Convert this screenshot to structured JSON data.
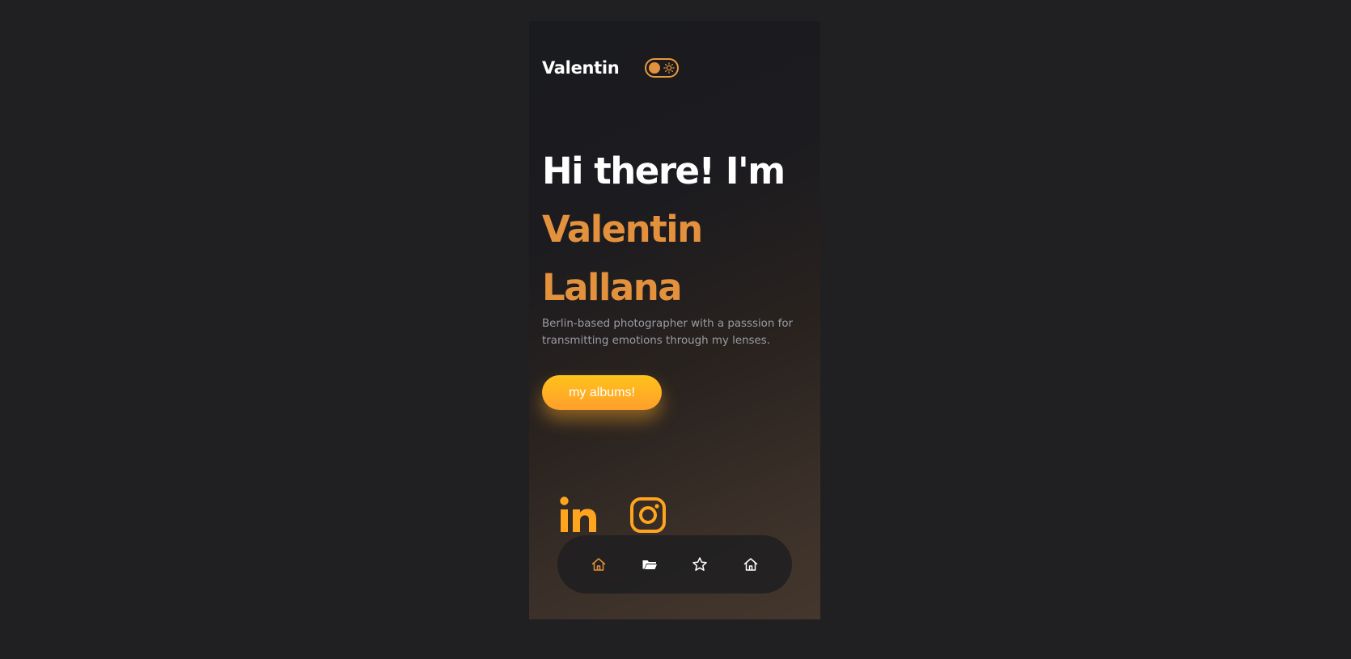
{
  "brand": {
    "name": "Valentin"
  },
  "theme_toggle": {
    "state": "on",
    "icon": "sun-icon"
  },
  "hero": {
    "greeting": "Hi there! I'm",
    "first_name": "Valentin",
    "last_name": "Lallana",
    "tagline": "Berlin-based photographer with a passsion for transmitting emotions through my lenses."
  },
  "cta": {
    "label": "my albums!"
  },
  "social": [
    {
      "icon": "linkedin-icon"
    },
    {
      "icon": "instagram-icon"
    }
  ],
  "bottom_nav": [
    {
      "icon": "home-icon",
      "active": true
    },
    {
      "icon": "folder-open-icon",
      "active": false
    },
    {
      "icon": "star-icon",
      "active": false
    },
    {
      "icon": "home-icon",
      "active": false
    }
  ],
  "colors": {
    "accent": "#e3913c",
    "button_top": "#ffc21a",
    "button_bottom": "#ff9f2c",
    "text": "#ffffff",
    "muted": "#9b9ca3",
    "nav_background": "#212021",
    "page_background": "#202022"
  }
}
